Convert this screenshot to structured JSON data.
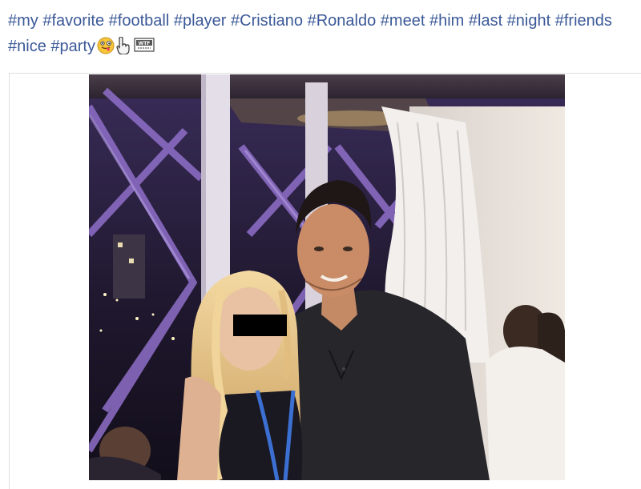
{
  "post": {
    "caption_tags": [
      "#my",
      "#favorite",
      "#football",
      "#player",
      "#Cristiano",
      "#Ronaldo",
      "#meet",
      "#him",
      "#last",
      "#night",
      "#friends",
      "#nice",
      "#party"
    ],
    "emojis": [
      "face-with-tongue-icon",
      "pointing-hand-icon",
      "wtf-sign-icon"
    ],
    "emoji_sign_text": "WTF"
  },
  "colors": {
    "link": "#3b5998",
    "frame_border": "#dddfe2",
    "photo_purple": "#8f6fc9",
    "censor_bar": "#000000"
  }
}
